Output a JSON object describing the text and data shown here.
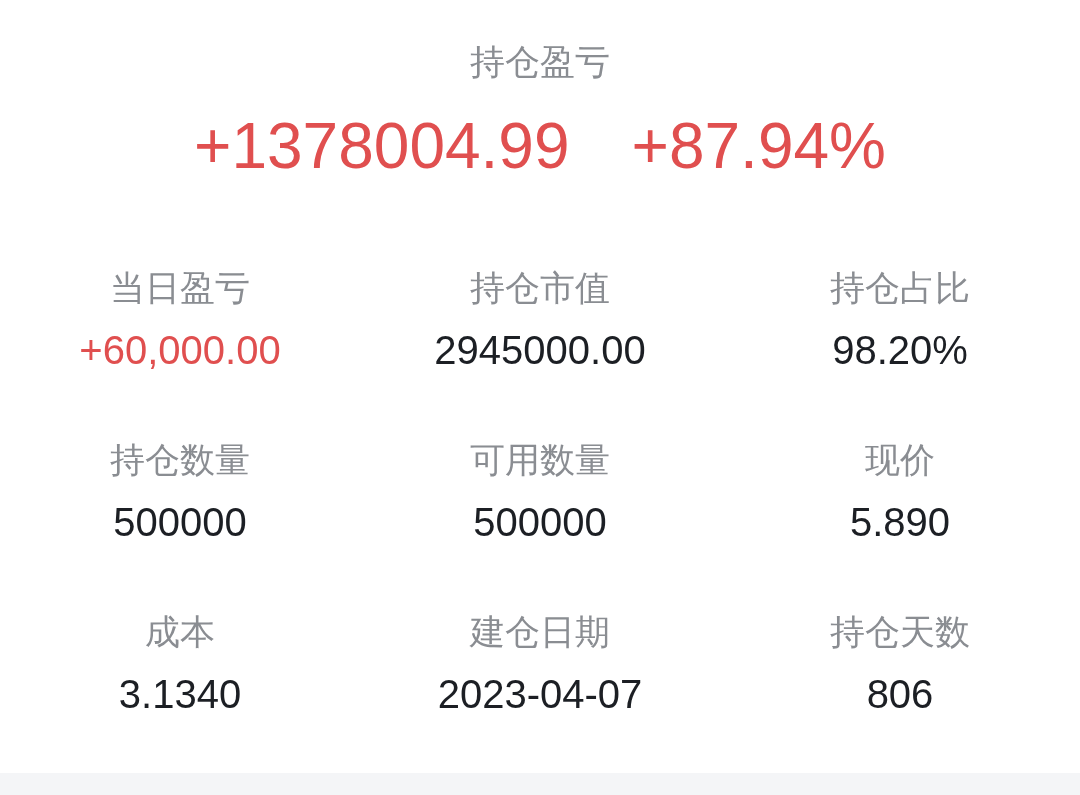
{
  "summary": {
    "title": "持仓盈亏",
    "amount": "+1378004.99",
    "percent": "+87.94%",
    "color": "#e04f4f"
  },
  "stats": [
    {
      "label": "当日盈亏",
      "value": "+60,000.00",
      "color": "#e04f4f"
    },
    {
      "label": "持仓市值",
      "value": "2945000.00",
      "color": "#1c1f24"
    },
    {
      "label": "持仓占比",
      "value": "98.20%",
      "color": "#1c1f24"
    },
    {
      "label": "持仓数量",
      "value": "500000",
      "color": "#1c1f24"
    },
    {
      "label": "可用数量",
      "value": "500000",
      "color": "#1c1f24"
    },
    {
      "label": "现价",
      "value": "5.890",
      "color": "#1c1f24"
    },
    {
      "label": "成本",
      "value": "3.1340",
      "color": "#1c1f24"
    },
    {
      "label": "建仓日期",
      "value": "2023-04-07",
      "color": "#1c1f24"
    },
    {
      "label": "持仓天数",
      "value": "806",
      "color": "#1c1f24"
    }
  ]
}
